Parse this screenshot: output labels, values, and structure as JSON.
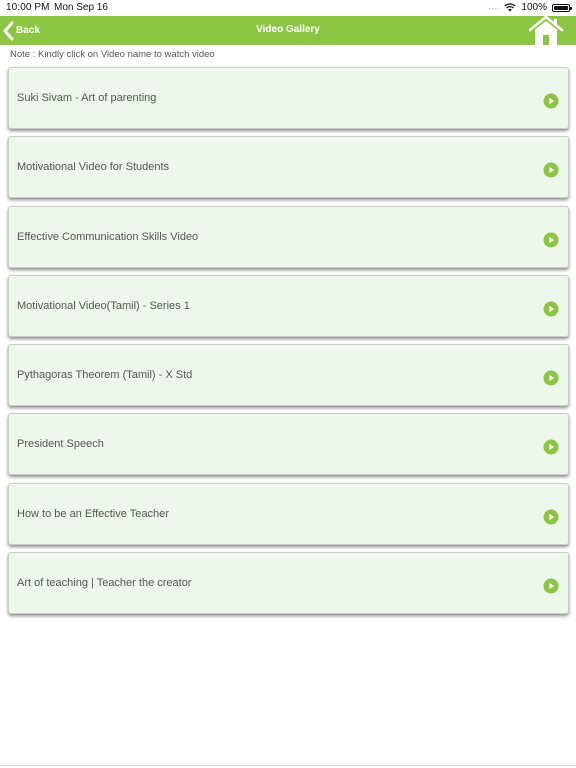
{
  "status_bar": {
    "time": "10:00 PM",
    "date": "Mon Sep 16",
    "signal": "....",
    "battery": "100%",
    "battery_level": 1.0
  },
  "nav": {
    "back_label": "Back",
    "title": "Video Gallery",
    "back_icon": "chevron-left-icon",
    "home_icon": "home-icon"
  },
  "note": "Note : Kindly click on Video name to watch video",
  "videos": [
    {
      "title": "Suki Sivam - Art of parenting"
    },
    {
      "title": "Motivational Video for Students"
    },
    {
      "title": "Effective Communication Skills Video"
    },
    {
      "title": "Motivational Video(Tamil) - Series 1"
    },
    {
      "title": "Pythagoras Theorem (Tamil) - X Std"
    },
    {
      "title": "President Speech"
    },
    {
      "title": "How to be an Effective Teacher"
    },
    {
      "title": "Art of teaching | Teacher the creator"
    }
  ],
  "colors": {
    "accent": "#8cc443",
    "card_background": "#eef7ec",
    "play_icon": "#8cc443"
  }
}
